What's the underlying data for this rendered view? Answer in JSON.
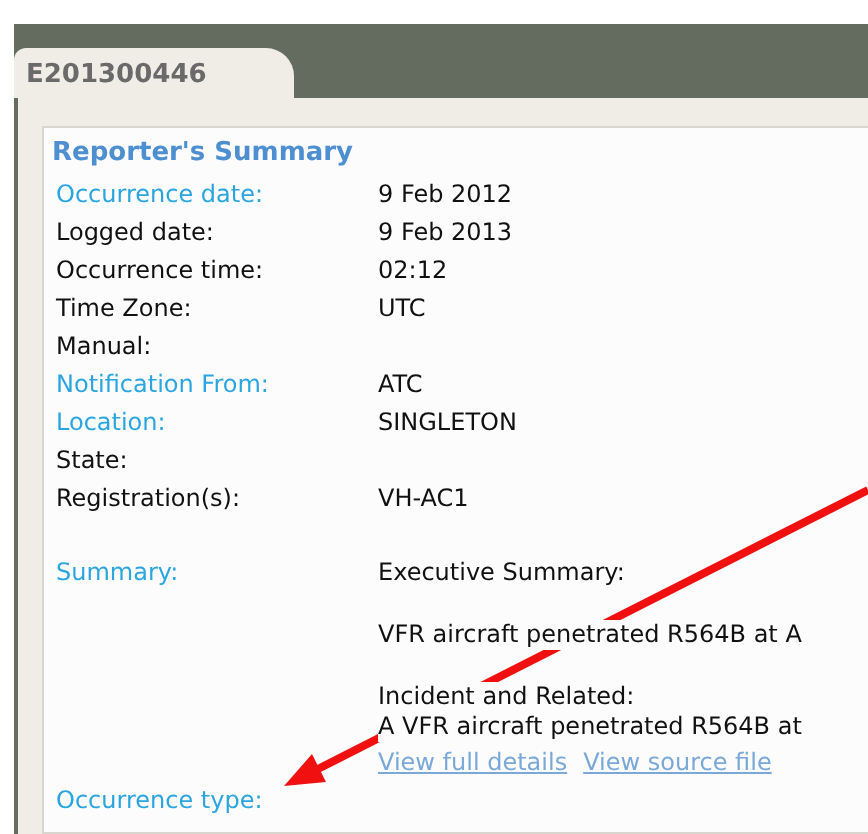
{
  "tab": {
    "label": "E201300446",
    "selected": true
  },
  "section_title": "Reporter's Summary",
  "fields": [
    {
      "label": "Occurrence date:",
      "highlighted": true,
      "value": "9 Feb 2012"
    },
    {
      "label": "Logged date:",
      "highlighted": false,
      "value": "9 Feb 2013"
    },
    {
      "label": "Occurrence time:",
      "highlighted": false,
      "value": "02:12"
    },
    {
      "label": "Time Zone:",
      "highlighted": false,
      "value": "UTC"
    },
    {
      "label": "Manual:",
      "highlighted": false
    },
    {
      "label": "Notification From:",
      "highlighted": true,
      "value": "ATC"
    },
    {
      "label": "Location:",
      "highlighted": true,
      "value": "SINGLETON"
    },
    {
      "label": "State:",
      "highlighted": false
    },
    {
      "label": "Registration(s):",
      "highlighted": false,
      "value": "VH-AC1"
    }
  ],
  "summary": {
    "label": "Summary:",
    "highlighted": true,
    "paragraphs": [
      [
        "Executive Summary:"
      ],
      [
        "VFR aircraft penetrated R564B at A"
      ],
      [
        "Incident and Related:",
        "A VFR aircraft penetrated R564B at"
      ]
    ],
    "links": [
      "View full details",
      "View source file"
    ]
  },
  "occurrence_type": {
    "label": "Occurrence type:",
    "highlighted": true
  }
}
